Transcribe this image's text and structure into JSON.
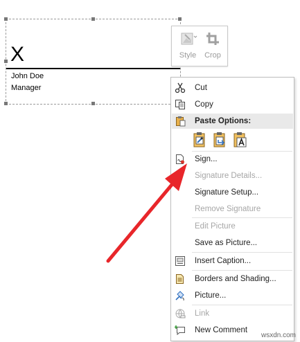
{
  "signature": {
    "mark": "X",
    "name": "John Doe",
    "title": "Manager"
  },
  "mini_toolbar": {
    "style_label": "Style",
    "crop_label": "Crop"
  },
  "context_menu": {
    "cut": "Cut",
    "copy": "Copy",
    "paste_options": "Paste Options:",
    "sign": "Sign...",
    "signature_details": "Signature Details...",
    "signature_setup": "Signature Setup...",
    "remove_signature": "Remove Signature",
    "edit_picture": "Edit Picture",
    "save_as_picture": "Save as Picture...",
    "insert_caption": "Insert Caption...",
    "borders_and_shading": "Borders and Shading...",
    "picture": "Picture...",
    "link": "Link",
    "new_comment": "New Comment"
  },
  "annotation": {
    "arrow_color": "#e8262a"
  },
  "watermark": "wsxdn.com"
}
